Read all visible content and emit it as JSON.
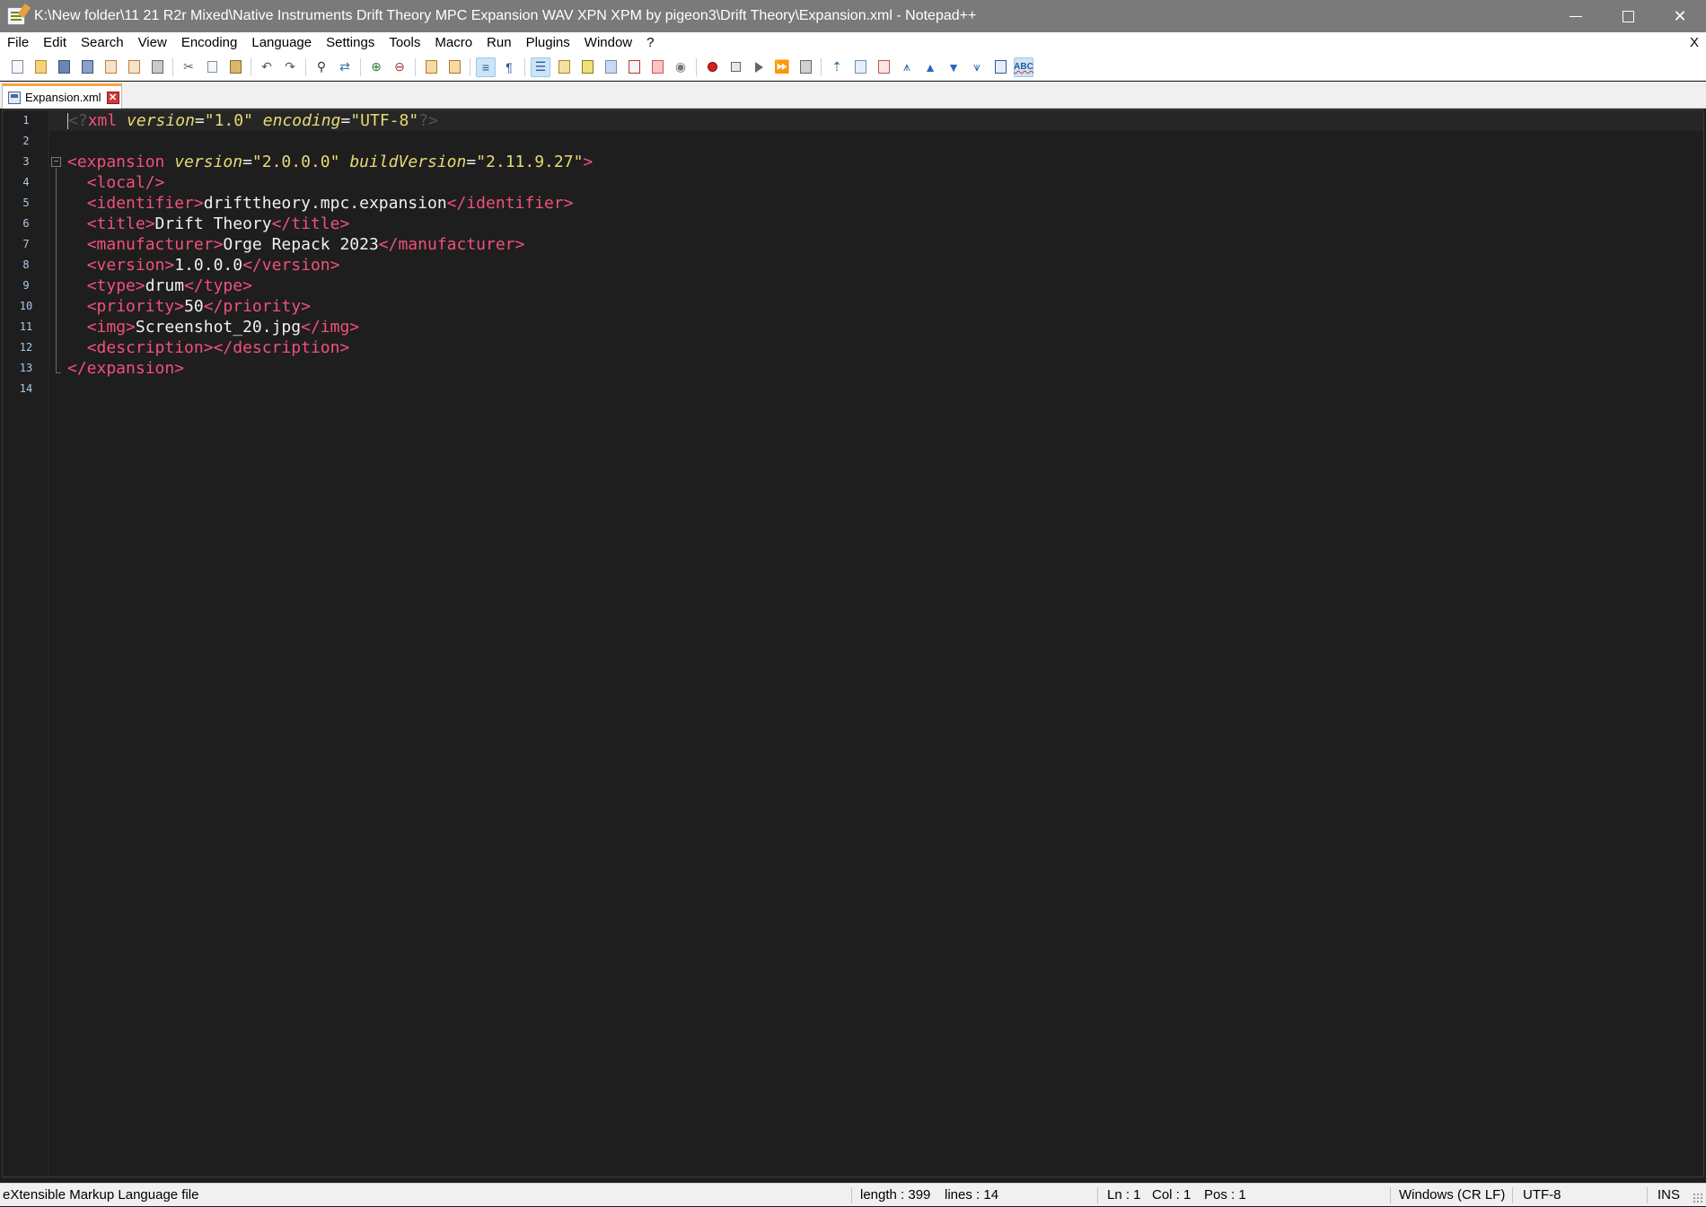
{
  "window": {
    "title": "K:\\New folder\\11 21 R2r Mixed\\Native Instruments Drift Theory MPC Expansion WAV XPN XPM by pigeon3\\Drift Theory\\Expansion.xml - Notepad++",
    "minimize_glyph": "—",
    "close_glyph": "✕"
  },
  "menu": {
    "items": [
      "File",
      "Edit",
      "Search",
      "View",
      "Encoding",
      "Language",
      "Settings",
      "Tools",
      "Macro",
      "Run",
      "Plugins",
      "Window",
      "?"
    ],
    "close_doc": "X"
  },
  "toolbar": {
    "icons": [
      "new-file-icon",
      "open-file-icon",
      "save-icon",
      "save-all-icon",
      "close-icon",
      "close-all-icon",
      "print-icon",
      "cut-icon",
      "copy-icon",
      "paste-icon",
      "undo-icon",
      "redo-icon",
      "find-icon",
      "replace-icon",
      "zoom-in-icon",
      "zoom-out-icon",
      "sync-vertical-icon",
      "sync-horizontal-icon",
      "word-wrap-icon",
      "show-all-chars-icon",
      "indent-guide-icon",
      "doc-map-icon",
      "function-list-icon",
      "folder-workspace-icon",
      "doc-list-icon",
      "monitoring-icon",
      "record-macro-icon",
      "stop-record-icon",
      "play-macro-icon",
      "run-macro-multiple-icon",
      "save-macro-icon",
      "up-icon",
      "list-icon",
      "list-alt-icon",
      "collapse-icon",
      "arrow-up-icon",
      "arrow-down-icon",
      "expand-icon",
      "panel-icon",
      "spellcheck-icon"
    ],
    "spellcheck_label": "ABC"
  },
  "tabs": [
    {
      "label": "Expansion.xml",
      "close_glyph": "✕"
    }
  ],
  "editor": {
    "line_numbers": [
      "1",
      "2",
      "3",
      "4",
      "5",
      "6",
      "7",
      "8",
      "9",
      "10",
      "11",
      "12",
      "13",
      "14"
    ],
    "fold_glyph": "−",
    "lines": {
      "l1": {
        "open": "<?",
        "name": "xml",
        "a1": "version",
        "v1": "\"1.0\"",
        "a2": "encoding",
        "v2": "\"UTF-8\"",
        "close": "?>"
      },
      "l3": {
        "open": "<expansion",
        "a1": "version",
        "v1": "\"2.0.0.0\"",
        "a2": "buildVersion",
        "v2": "\"2.11.9.27\"",
        "close": ">"
      },
      "l4": {
        "tag": "<local/>"
      },
      "l5": {
        "open": "<identifier>",
        "text": "drifttheory.mpc.expansion",
        "close": "</identifier>"
      },
      "l6": {
        "open": "<title>",
        "text": "Drift Theory",
        "close": "</title>"
      },
      "l7": {
        "open": "<manufacturer>",
        "text": "Orge Repack 2023",
        "close": "</manufacturer>"
      },
      "l8": {
        "open": "<version>",
        "text": "1.0.0.0",
        "close": "</version>"
      },
      "l9": {
        "open": "<type>",
        "text": "drum",
        "close": "</type>"
      },
      "l10": {
        "open": "<priority>",
        "text": "50",
        "close": "</priority>"
      },
      "l11": {
        "open": "<img>",
        "text": "Screenshot_20.jpg",
        "close": "</img>"
      },
      "l12": {
        "open": "<description>",
        "close": "</description>"
      },
      "l13": {
        "tag": "</expansion>"
      }
    }
  },
  "status": {
    "file_type": "eXtensible Markup Language file",
    "length": "length : 399",
    "lines": "lines : 14",
    "ln": "Ln : 1",
    "col": "Col : 1",
    "pos": "Pos : 1",
    "eol": "Windows (CR LF)",
    "encoding": "UTF-8",
    "mode": "INS"
  },
  "colors": {
    "tag": "#f2507b",
    "attr": "#e6db74",
    "text": "#f0f0f0",
    "background": "#1e1e1e",
    "tab_accent": "#f7a541"
  }
}
